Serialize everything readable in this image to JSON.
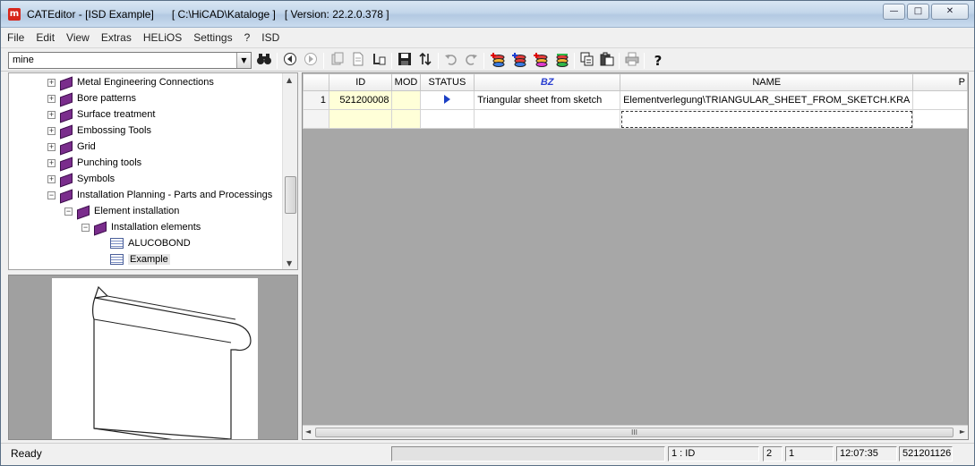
{
  "window": {
    "title": "CATEditor - [ISD Example]      [ C:\\HiCAD\\Kataloge ]   [ Version: 22.2.0.378 ]",
    "minimize_glyph": "—",
    "maximize_glyph": "□",
    "close_glyph": "✕",
    "app_icon": "m"
  },
  "menu": [
    "File",
    "Edit",
    "View",
    "Extras",
    "HELiOS",
    "Settings",
    "?",
    "ISD"
  ],
  "toolbar": {
    "combo_value": "mine",
    "icons": [
      "binoculars-icon",
      "back-icon",
      "forward-icon",
      "copy-entry-icon",
      "document-icon",
      "new-entry-icon",
      "save-icon",
      "sort-icon",
      "undo-icon",
      "redo-icon",
      "db-add-icon",
      "db-add-red-icon",
      "db-add-blue-icon",
      "db-green-icon",
      "copy-icon",
      "paste-icon",
      "print-icon",
      "help-icon"
    ]
  },
  "tree": {
    "items": [
      {
        "label": "Metal Engineering Connections",
        "level": 1,
        "expander": "+",
        "icon": "book"
      },
      {
        "label": "Bore patterns",
        "level": 1,
        "expander": "+",
        "icon": "book"
      },
      {
        "label": "Surface treatment",
        "level": 1,
        "expander": "+",
        "icon": "book"
      },
      {
        "label": "Embossing Tools",
        "level": 1,
        "expander": "+",
        "icon": "book"
      },
      {
        "label": "Grid",
        "level": 1,
        "expander": "+",
        "icon": "book"
      },
      {
        "label": "Punching tools",
        "level": 1,
        "expander": "+",
        "icon": "book"
      },
      {
        "label": "Symbols",
        "level": 1,
        "expander": "+",
        "icon": "book"
      },
      {
        "label": "Installation Planning - Parts and Processings",
        "level": 1,
        "expander": "−",
        "icon": "book"
      },
      {
        "label": "Element installation",
        "level": 2,
        "expander": "−",
        "icon": "book"
      },
      {
        "label": "Installation elements",
        "level": 3,
        "expander": "−",
        "icon": "book"
      },
      {
        "label": "ALUCOBOND",
        "level": 4,
        "expander": "",
        "icon": "table"
      },
      {
        "label": "Example",
        "level": 4,
        "expander": "",
        "icon": "table",
        "selected": true
      }
    ]
  },
  "grid": {
    "columns": [
      "",
      "ID",
      "MOD",
      "STATUS",
      "BZ",
      "NAME",
      "P"
    ],
    "rows": [
      {
        "num": "1",
        "id": "521200008",
        "mod": "",
        "status": "arrow",
        "bz": "Triangular sheet from sketch",
        "name": "Elementverlegung\\TRIANGULAR_SHEET_FROM_SKETCH.KRA"
      }
    ],
    "hscroll_grip": "III"
  },
  "status": {
    "ready": "Ready",
    "panels": [
      "",
      "1 : ID",
      "2",
      "1",
      "12:07:35",
      "521201126"
    ]
  },
  "colors": {
    "grid_background": "#a7a7a7",
    "bz_header": "#2a3fd0",
    "id_cell": "#ffffd8",
    "book": "#7a2d8c"
  }
}
